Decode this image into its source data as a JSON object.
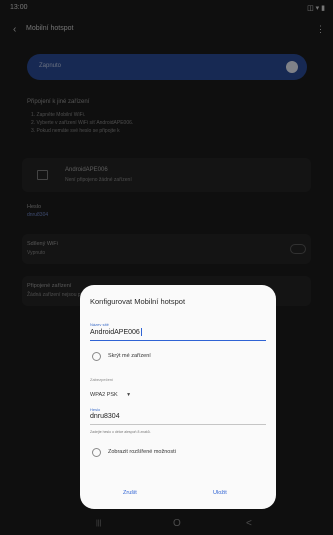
{
  "status_bar": {
    "time": "13:00",
    "icons": "◫ ▾ ▮"
  },
  "header": {
    "back_icon": "arrow-left",
    "title": "Mobilní hotspot",
    "more_icon": "more-vertical"
  },
  "master_switch": {
    "label": "Zapnuto",
    "on": true
  },
  "instructions": {
    "heading": "Připojení k jiné zařízení",
    "steps": [
      "1. Zapněte Mobilní WiFi.",
      "2. Vyberte v zařízení WiFi síť AndroidAPE006.",
      "3. Pokud nemáte své heslo se připojte k"
    ]
  },
  "network": {
    "name": "AndroidAPE006",
    "subtitle": "Není připojeno žádné zařízení"
  },
  "password_row": {
    "label": "Heslo",
    "value": "dnru8304"
  },
  "save_wifi_row": {
    "label": "Sdílený WiFi",
    "sublabel": "Vypnuto"
  },
  "connected_row": {
    "label": "Připojené zařízení",
    "sublabel": "Žádná zařízení nejsou připojena"
  },
  "dialog": {
    "title": "Konfigurovat Mobilní hotspot",
    "network_name_label": "Název sítě",
    "network_name_value": "AndroidAPE006",
    "hide_device_label": "Skrýt mé zařízení",
    "security_label": "Zabezpečení",
    "security_value": "WPA2 PSK",
    "password_label": "Heslo",
    "password_value": "dnru8304",
    "password_helper": "Zadejte heslo o délce alespoň 8 znaků.",
    "show_advanced_label": "Zobrazit rozšířené možnosti",
    "cancel_label": "Zrušit",
    "save_label": "Uložit"
  },
  "nav_bar": {
    "recents": "|||",
    "home": "O",
    "back": "<"
  },
  "colors": {
    "accent": "#2f63d4",
    "switch_bg": "#2a4c97",
    "dialog_bg": "#fafafa",
    "screen_bg": "#1d1d1d"
  }
}
